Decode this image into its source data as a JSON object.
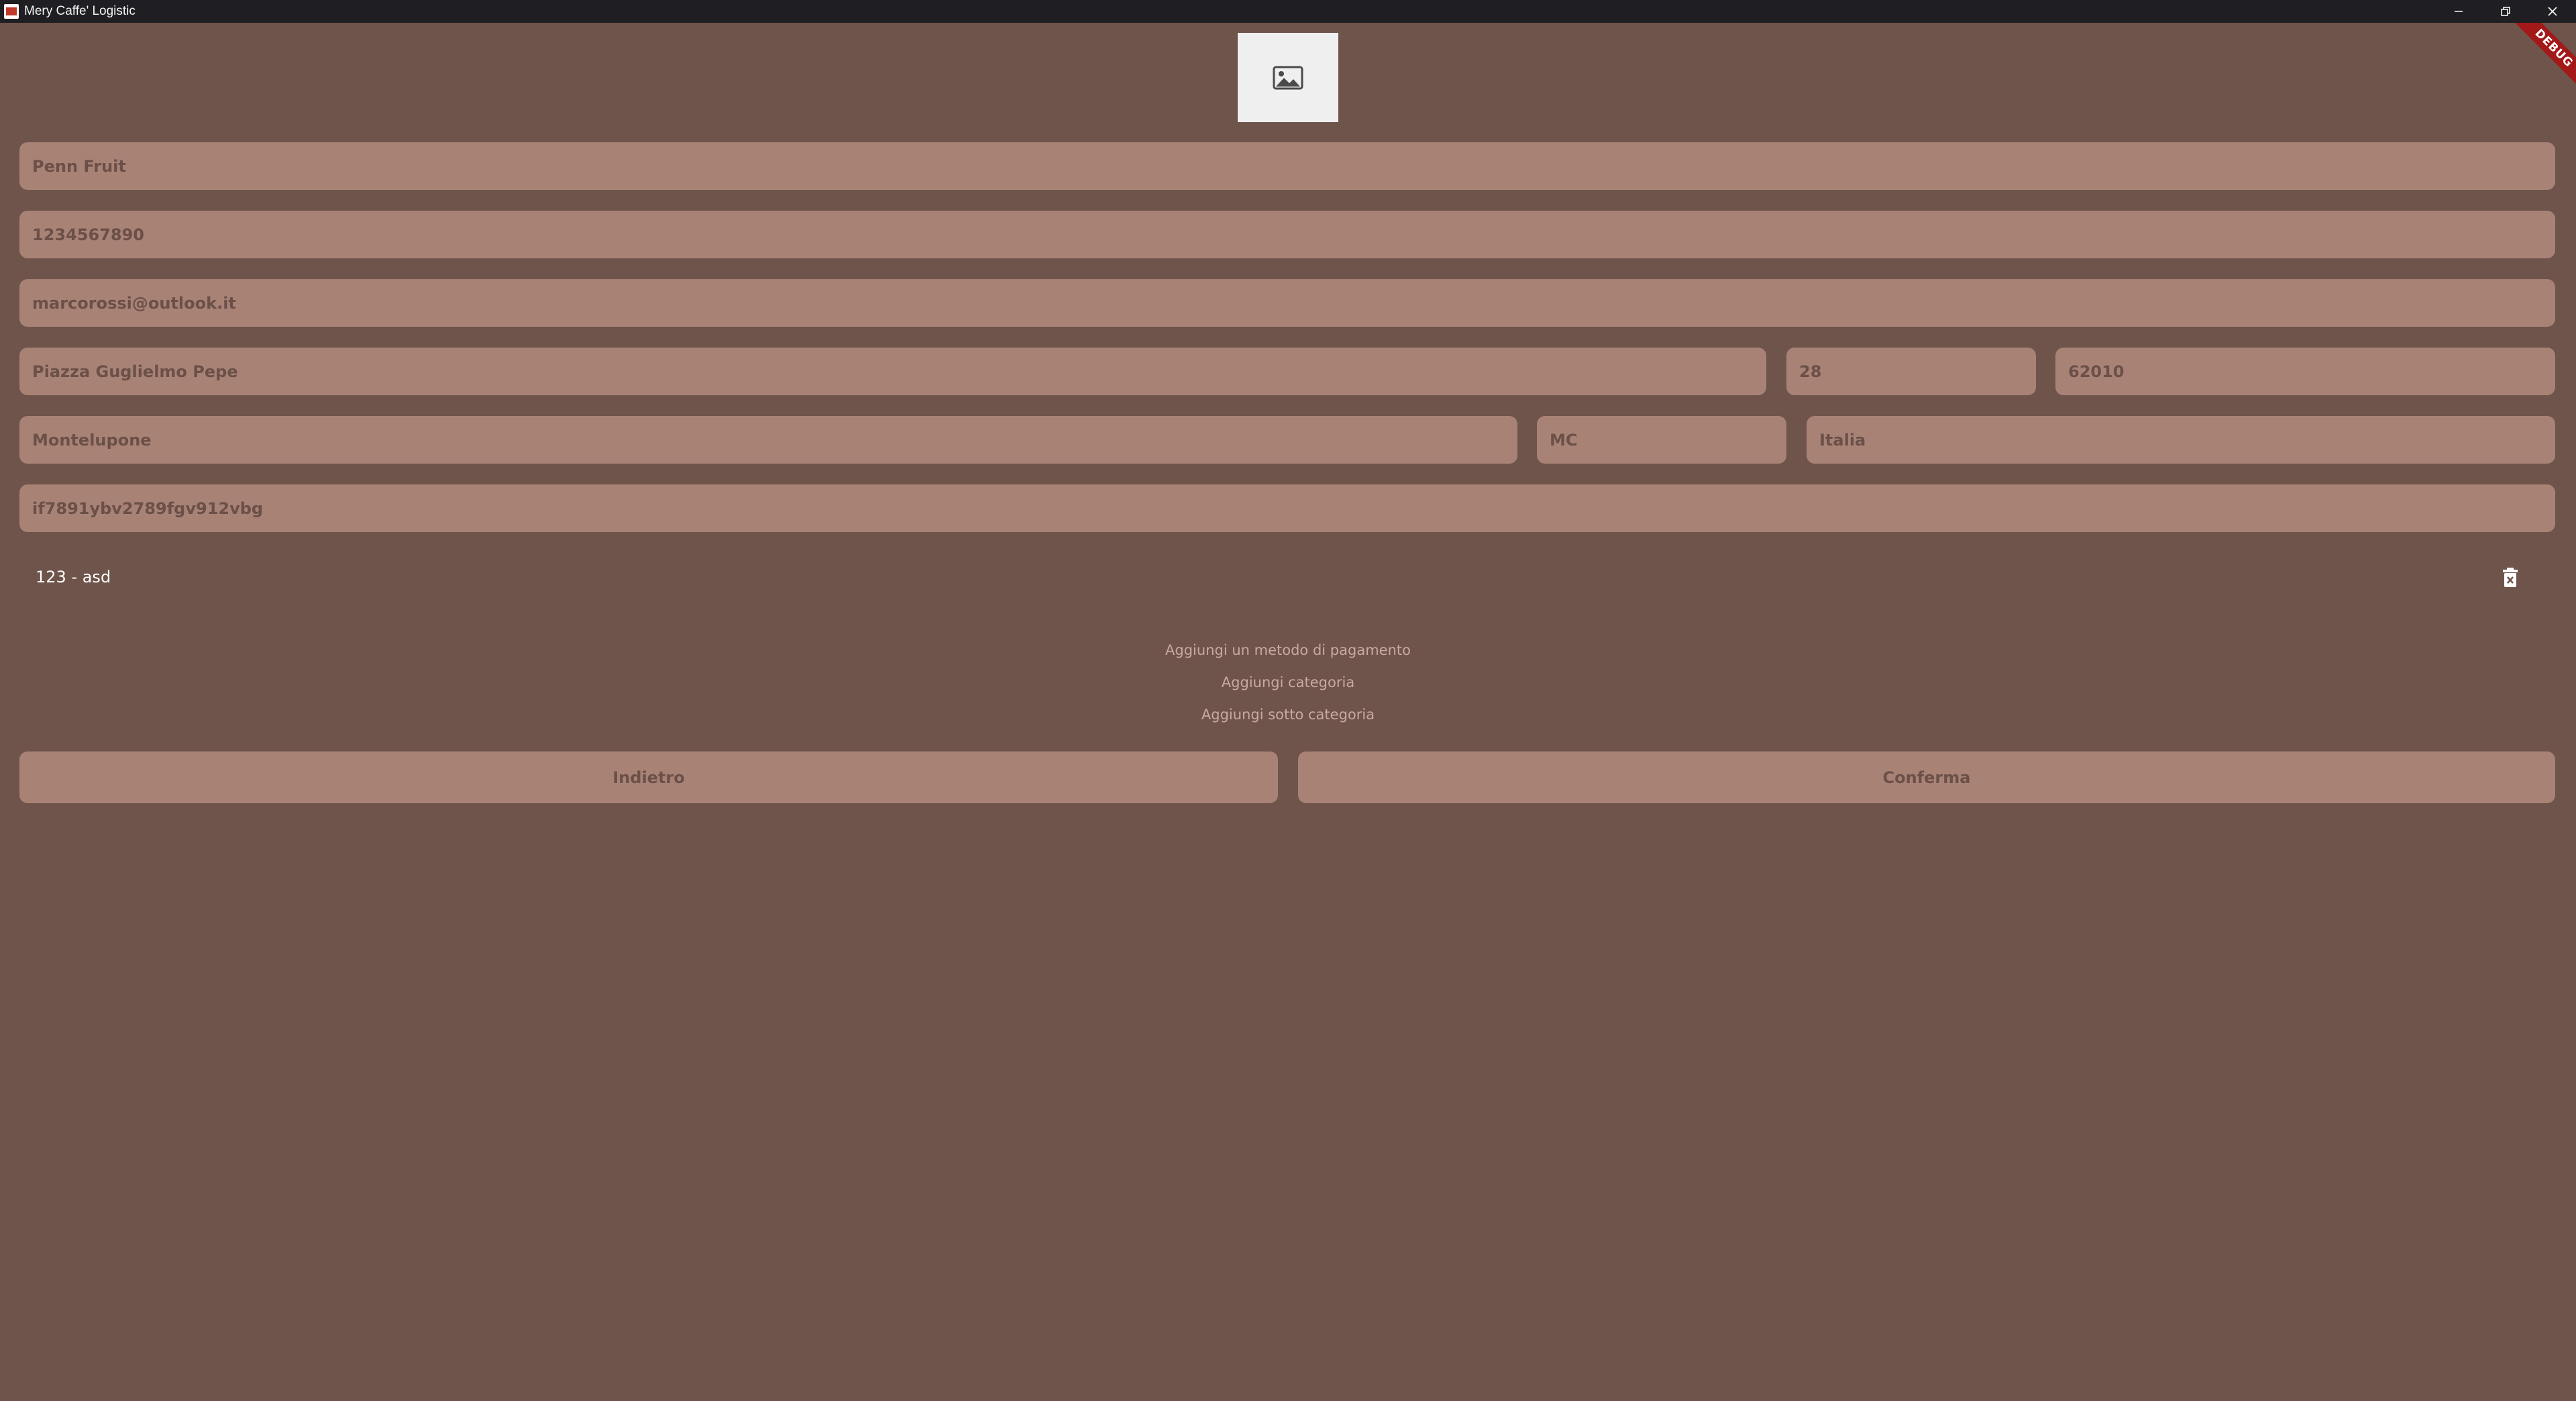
{
  "window": {
    "title": "Mery Caffe' Logistic",
    "debug_label": "DEBUG"
  },
  "logo": {
    "icon": "image-placeholder-icon"
  },
  "form": {
    "name": "Penn Fruit",
    "phone": "1234567890",
    "email": "marcorossi@outlook.it",
    "street": "Piazza Guglielmo Pepe",
    "number": "28",
    "zip": "62010",
    "city": "Montelupone",
    "province": "MC",
    "country": "Italia",
    "code": "if7891ybv2789fgv912vbg"
  },
  "payment_methods": [
    {
      "label": "123 - asd",
      "icon": "trash-icon"
    }
  ],
  "links": {
    "add_payment": "Aggiungi un metodo di pagamento",
    "add_category": "Aggiungi categoria",
    "add_subcategory": "Aggiungi sotto categoria"
  },
  "buttons": {
    "back": "Indietro",
    "confirm": "Conferma"
  },
  "colors": {
    "background": "#6e544b",
    "field": "#a98276",
    "field_text": "#6b5048",
    "link_text": "#c9aaa0",
    "titlebar": "#1f1f23",
    "debug_banner": "#a3191a"
  }
}
